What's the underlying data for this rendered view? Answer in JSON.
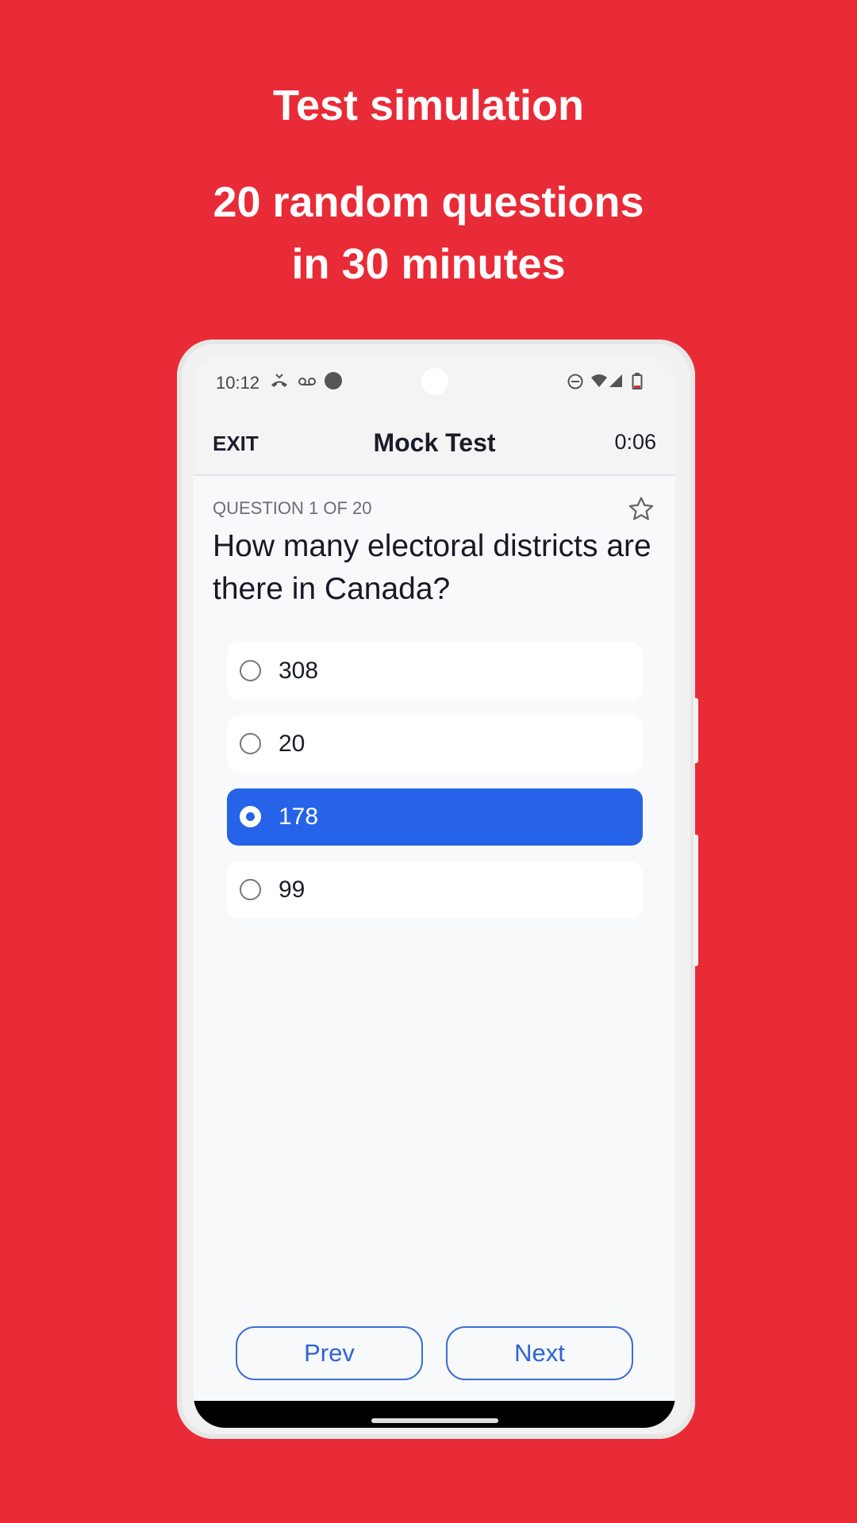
{
  "promo": {
    "title": "Test simulation",
    "subtitle_line1": "20 random questions",
    "subtitle_line2": "in 30 minutes"
  },
  "status_bar": {
    "time": "10:12",
    "icons_left": [
      "missed-call-icon",
      "voicemail-icon",
      "notification-dot-icon"
    ],
    "icons_right": [
      "dnd-icon",
      "wifi-icon",
      "signal-icon",
      "battery-icon"
    ]
  },
  "app_bar": {
    "exit_label": "EXIT",
    "title": "Mock Test",
    "timer": "0:06"
  },
  "question": {
    "counter": "QUESTION 1 OF 20",
    "text": "How many electoral districts are there in Canada?",
    "bookmark_icon": "star-icon"
  },
  "options": [
    {
      "label": "308",
      "selected": false
    },
    {
      "label": "20",
      "selected": false
    },
    {
      "label": "178",
      "selected": true
    },
    {
      "label": "99",
      "selected": false
    }
  ],
  "navigation": {
    "prev_label": "Prev",
    "next_label": "Next"
  },
  "colors": {
    "background": "#E92B37",
    "accent": "#2763E8"
  }
}
